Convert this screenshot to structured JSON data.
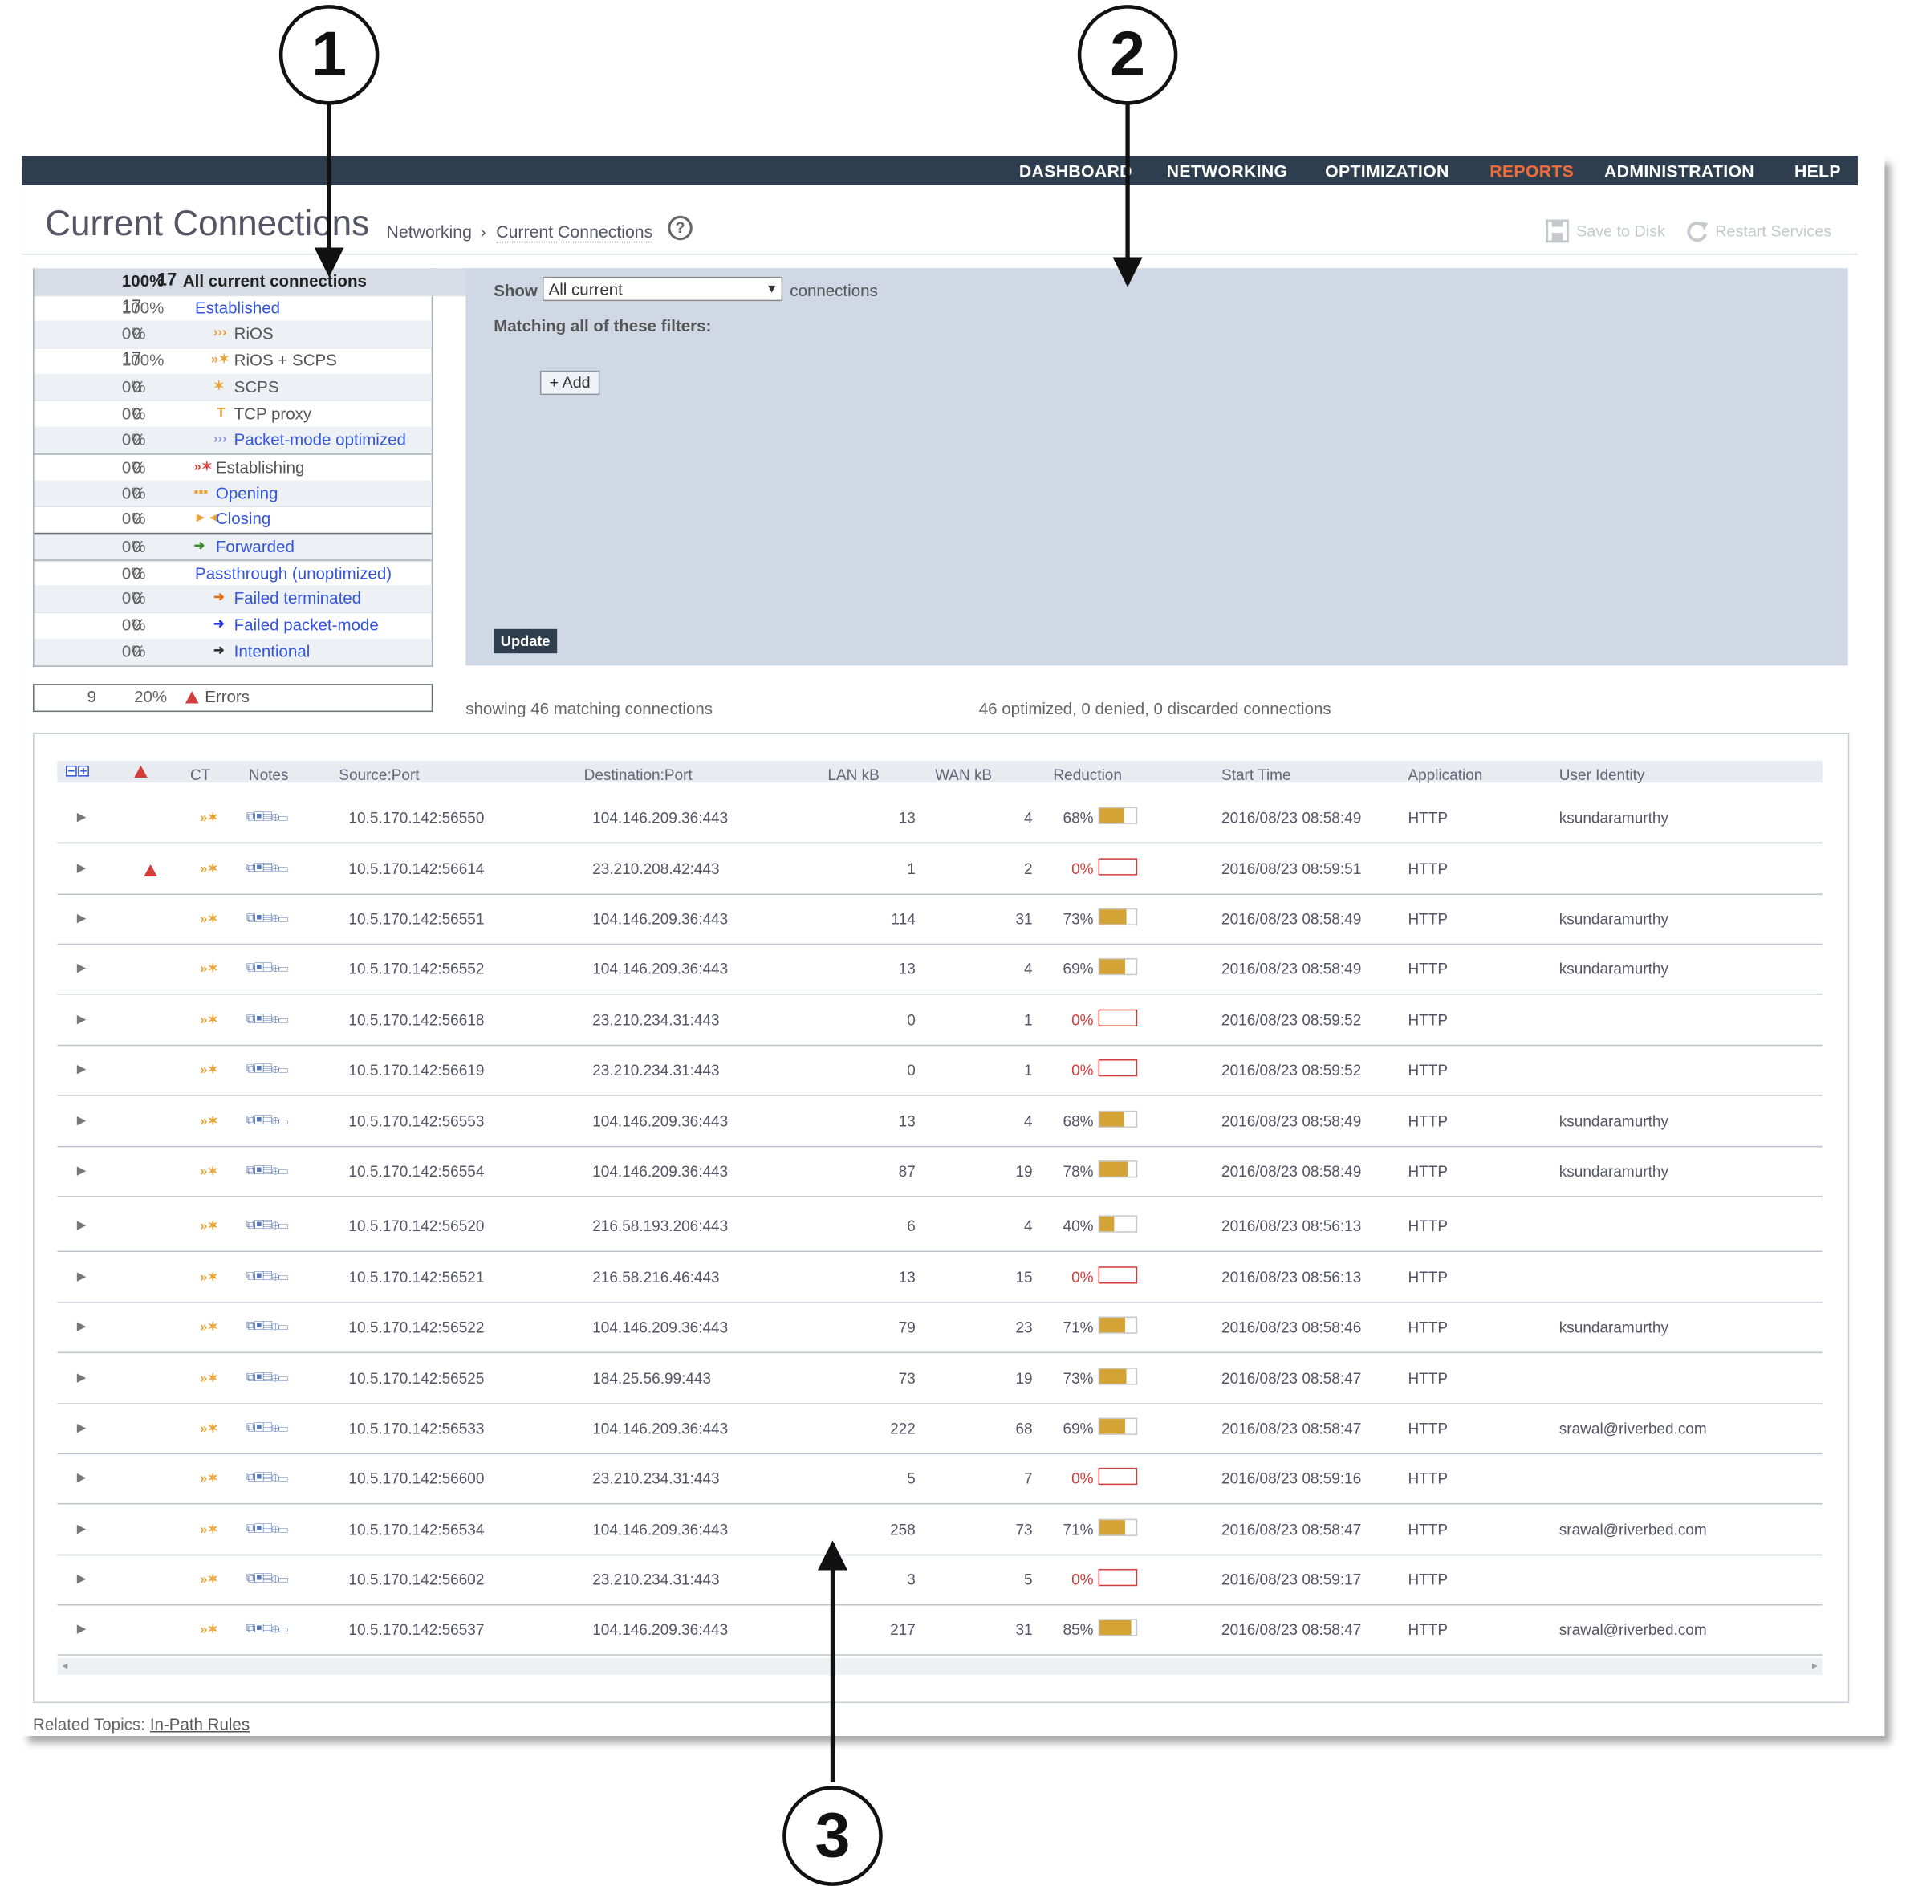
{
  "callouts": [
    "1",
    "2",
    "3"
  ],
  "nav": [
    "DASHBOARD",
    "NETWORKING",
    "OPTIMIZATION",
    "REPORTS",
    "ADMINISTRATION",
    "HELP"
  ],
  "nav_active": "REPORTS",
  "page_title": "Current Connections",
  "breadcrumb": [
    "Networking",
    "›",
    "Current Connections"
  ],
  "help_icon": "?",
  "top_actions": {
    "save": "Save to Disk",
    "restart": "Restart Services"
  },
  "summary": [
    {
      "count": "17",
      "pct": "100%",
      "label": "All current connections",
      "bold": true
    },
    {
      "count": "17",
      "pct": "100%",
      "label": "Established"
    },
    {
      "count": "0",
      "pct": "0%",
      "label": "RiOS",
      "icon": "rios-icon"
    },
    {
      "count": "17",
      "pct": "100%",
      "label": "RiOS + SCPS",
      "icon": "rios-scps-icon"
    },
    {
      "count": "0",
      "pct": "0%",
      "label": "SCPS",
      "icon": "scps-icon"
    },
    {
      "count": "0",
      "pct": "0%",
      "label": "TCP proxy",
      "icon": "tcp-proxy-icon"
    },
    {
      "count": "0",
      "pct": "0%",
      "label": "Packet-mode optimized",
      "icon": "packet-mode-icon"
    },
    {
      "count": "0",
      "pct": "0%",
      "label": "Establishing",
      "icon": "establishing-icon"
    },
    {
      "count": "0",
      "pct": "0%",
      "label": "Opening",
      "icon": "opening-icon"
    },
    {
      "count": "0",
      "pct": "0%",
      "label": "Closing",
      "icon": "closing-icon"
    },
    {
      "count": "0",
      "pct": "0%",
      "label": "Forwarded",
      "icon": "forwarded-icon"
    },
    {
      "count": "0",
      "pct": "0%",
      "label": "Passthrough (unoptimized)"
    },
    {
      "count": "0",
      "pct": "0%",
      "label": "Failed terminated",
      "icon": "failed-terminated-icon"
    },
    {
      "count": "0",
      "pct": "0%",
      "label": "Failed packet-mode",
      "icon": "failed-packet-mode-icon"
    },
    {
      "count": "0",
      "pct": "0%",
      "label": "Intentional",
      "icon": "intentional-icon"
    }
  ],
  "errors": {
    "count": "9",
    "pct": "20%",
    "label": "Errors"
  },
  "filter": {
    "show_label": "Show",
    "select_value": "All current",
    "connections_label": "connections",
    "matching_label": "Matching all of these filters:",
    "add_button": "+ Add",
    "update_button": "Update"
  },
  "status": {
    "showing": "showing 46 matching connections",
    "summary": "46 optimized, 0 denied, 0 discarded connections"
  },
  "columns": [
    "CT",
    "Notes",
    "Source:Port",
    "Destination:Port",
    "LAN kB",
    "WAN kB",
    "Reduction",
    "Start Time",
    "Application",
    "User Identity"
  ],
  "rows": [
    {
      "error": false,
      "source": "10.5.170.142:56550",
      "dest": "104.146.209.36:443",
      "lan": "13",
      "wan": "4",
      "reduction": "68%",
      "reduction_value": 68,
      "start": "2016/08/23 08:58:49",
      "app": "HTTP",
      "user": "ksundaramurthy"
    },
    {
      "error": true,
      "source": "10.5.170.142:56614",
      "dest": "23.210.208.42:443",
      "lan": "1",
      "wan": "2",
      "reduction": "0%",
      "reduction_value": 0,
      "start": "2016/08/23 08:59:51",
      "app": "HTTP",
      "user": ""
    },
    {
      "error": false,
      "source": "10.5.170.142:56551",
      "dest": "104.146.209.36:443",
      "lan": "114",
      "wan": "31",
      "reduction": "73%",
      "reduction_value": 73,
      "start": "2016/08/23 08:58:49",
      "app": "HTTP",
      "user": "ksundaramurthy"
    },
    {
      "error": false,
      "source": "10.5.170.142:56552",
      "dest": "104.146.209.36:443",
      "lan": "13",
      "wan": "4",
      "reduction": "69%",
      "reduction_value": 69,
      "start": "2016/08/23 08:58:49",
      "app": "HTTP",
      "user": "ksundaramurthy"
    },
    {
      "error": false,
      "source": "10.5.170.142:56618",
      "dest": "23.210.234.31:443",
      "lan": "0",
      "wan": "1",
      "reduction": "0%",
      "reduction_value": 0,
      "start": "2016/08/23 08:59:52",
      "app": "HTTP",
      "user": ""
    },
    {
      "error": false,
      "source": "10.5.170.142:56619",
      "dest": "23.210.234.31:443",
      "lan": "0",
      "wan": "1",
      "reduction": "0%",
      "reduction_value": 0,
      "start": "2016/08/23 08:59:52",
      "app": "HTTP",
      "user": ""
    },
    {
      "error": false,
      "source": "10.5.170.142:56553",
      "dest": "104.146.209.36:443",
      "lan": "13",
      "wan": "4",
      "reduction": "68%",
      "reduction_value": 68,
      "start": "2016/08/23 08:58:49",
      "app": "HTTP",
      "user": "ksundaramurthy"
    },
    {
      "error": false,
      "source": "10.5.170.142:56554",
      "dest": "104.146.209.36:443",
      "lan": "87",
      "wan": "19",
      "reduction": "78%",
      "reduction_value": 78,
      "start": "2016/08/23 08:58:49",
      "app": "HTTP",
      "user": "ksundaramurthy"
    },
    {
      "error": false,
      "source": "10.5.170.142:56520",
      "dest": "216.58.193.206:443",
      "lan": "6",
      "wan": "4",
      "reduction": "40%",
      "reduction_value": 40,
      "start": "2016/08/23 08:56:13",
      "app": "HTTP",
      "user": ""
    },
    {
      "error": false,
      "source": "10.5.170.142:56521",
      "dest": "216.58.216.46:443",
      "lan": "13",
      "wan": "15",
      "reduction": "0%",
      "reduction_value": 0,
      "start": "2016/08/23 08:56:13",
      "app": "HTTP",
      "user": ""
    },
    {
      "error": false,
      "source": "10.5.170.142:56522",
      "dest": "104.146.209.36:443",
      "lan": "79",
      "wan": "23",
      "reduction": "71%",
      "reduction_value": 71,
      "start": "2016/08/23 08:58:46",
      "app": "HTTP",
      "user": "ksundaramurthy"
    },
    {
      "error": false,
      "source": "10.5.170.142:56525",
      "dest": "184.25.56.99:443",
      "lan": "73",
      "wan": "19",
      "reduction": "73%",
      "reduction_value": 73,
      "start": "2016/08/23 08:58:47",
      "app": "HTTP",
      "user": ""
    },
    {
      "error": false,
      "source": "10.5.170.142:56533",
      "dest": "104.146.209.36:443",
      "lan": "222",
      "wan": "68",
      "reduction": "69%",
      "reduction_value": 69,
      "start": "2016/08/23 08:58:47",
      "app": "HTTP",
      "user": "srawal@riverbed.com"
    },
    {
      "error": false,
      "source": "10.5.170.142:56600",
      "dest": "23.210.234.31:443",
      "lan": "5",
      "wan": "7",
      "reduction": "0%",
      "reduction_value": 0,
      "start": "2016/08/23 08:59:16",
      "app": "HTTP",
      "user": ""
    },
    {
      "error": false,
      "source": "10.5.170.142:56534",
      "dest": "104.146.209.36:443",
      "lan": "258",
      "wan": "73",
      "reduction": "71%",
      "reduction_value": 71,
      "start": "2016/08/23 08:58:47",
      "app": "HTTP",
      "user": "srawal@riverbed.com"
    },
    {
      "error": false,
      "source": "10.5.170.142:56602",
      "dest": "23.210.234.31:443",
      "lan": "3",
      "wan": "5",
      "reduction": "0%",
      "reduction_value": 0,
      "start": "2016/08/23 08:59:17",
      "app": "HTTP",
      "user": ""
    },
    {
      "error": false,
      "source": "10.5.170.142:56537",
      "dest": "104.146.209.36:443",
      "lan": "217",
      "wan": "31",
      "reduction": "85%",
      "reduction_value": 85,
      "start": "2016/08/23 08:58:47",
      "app": "HTTP",
      "user": "srawal@riverbed.com"
    }
  ],
  "footer": {
    "label": "Related Topics:",
    "link": "In-Path Rules"
  },
  "colors": {
    "navbar": "#2f3e4e",
    "active_nav": "#f06c3b",
    "filter_panel": "#d1d8e5",
    "reduction_bar": "#d4a336",
    "zero_reduction": "#d43c3c",
    "link": "#3355dd"
  }
}
